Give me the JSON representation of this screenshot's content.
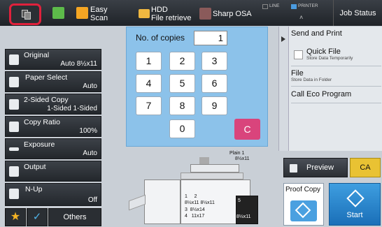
{
  "topbar": {
    "easy_scan_line1": "Easy",
    "easy_scan_line2": "Scan",
    "hdd_line1": "HDD",
    "hdd_line2": "File retrieve",
    "sharp_osa": "Sharp OSA",
    "status_line": "LINE",
    "status_printer": "PRINTER",
    "job_status": "Job Status"
  },
  "settings": [
    {
      "label": "Original",
      "value": "Auto  8½x11"
    },
    {
      "label": "Paper Select",
      "value": "Auto"
    },
    {
      "label": "2-Sided Copy",
      "value": "1-Sided 1-Sided"
    },
    {
      "label": "Copy Ratio",
      "value": "100%"
    },
    {
      "label": "Exposure",
      "value": "Auto"
    },
    {
      "label": "Output",
      "value": ""
    },
    {
      "label": "N-Up",
      "value": "Off"
    }
  ],
  "bottom_left": {
    "others": "Others"
  },
  "keypad": {
    "copies_label": "No. of copies",
    "copies_value": "1",
    "keys": [
      "1",
      "2",
      "3",
      "4",
      "5",
      "6",
      "7",
      "8",
      "9",
      "0"
    ],
    "clear": "C"
  },
  "right_panel": {
    "send_print": "Send and Print",
    "quick_file": "Quick File",
    "quick_file_sub": "Store Data Temporarily",
    "file": "File",
    "file_sub": "Store Data in Folder",
    "eco": "Call Eco Program"
  },
  "machine": {
    "plain_label": "Plain 1",
    "plain_size": "8½x11",
    "tray1": "1",
    "tray2": "2",
    "tray1_size": "8½x11",
    "tray2_size": "8½x11",
    "tray3": "3",
    "tray3_size": "8½x14",
    "tray4": "4",
    "tray4_size": "11x17",
    "tray5": "5",
    "tray5_size": "8½x11"
  },
  "actions": {
    "preview": "Preview",
    "ca": "CA",
    "proof_copy": "Proof Copy",
    "start": "Start"
  },
  "colors": {
    "home_border": "#e0213c",
    "keypad_bg": "#8cc2ea",
    "clear_key": "#d9447c",
    "ca_button": "#e9c233",
    "start_button": "#1a6fb8"
  }
}
